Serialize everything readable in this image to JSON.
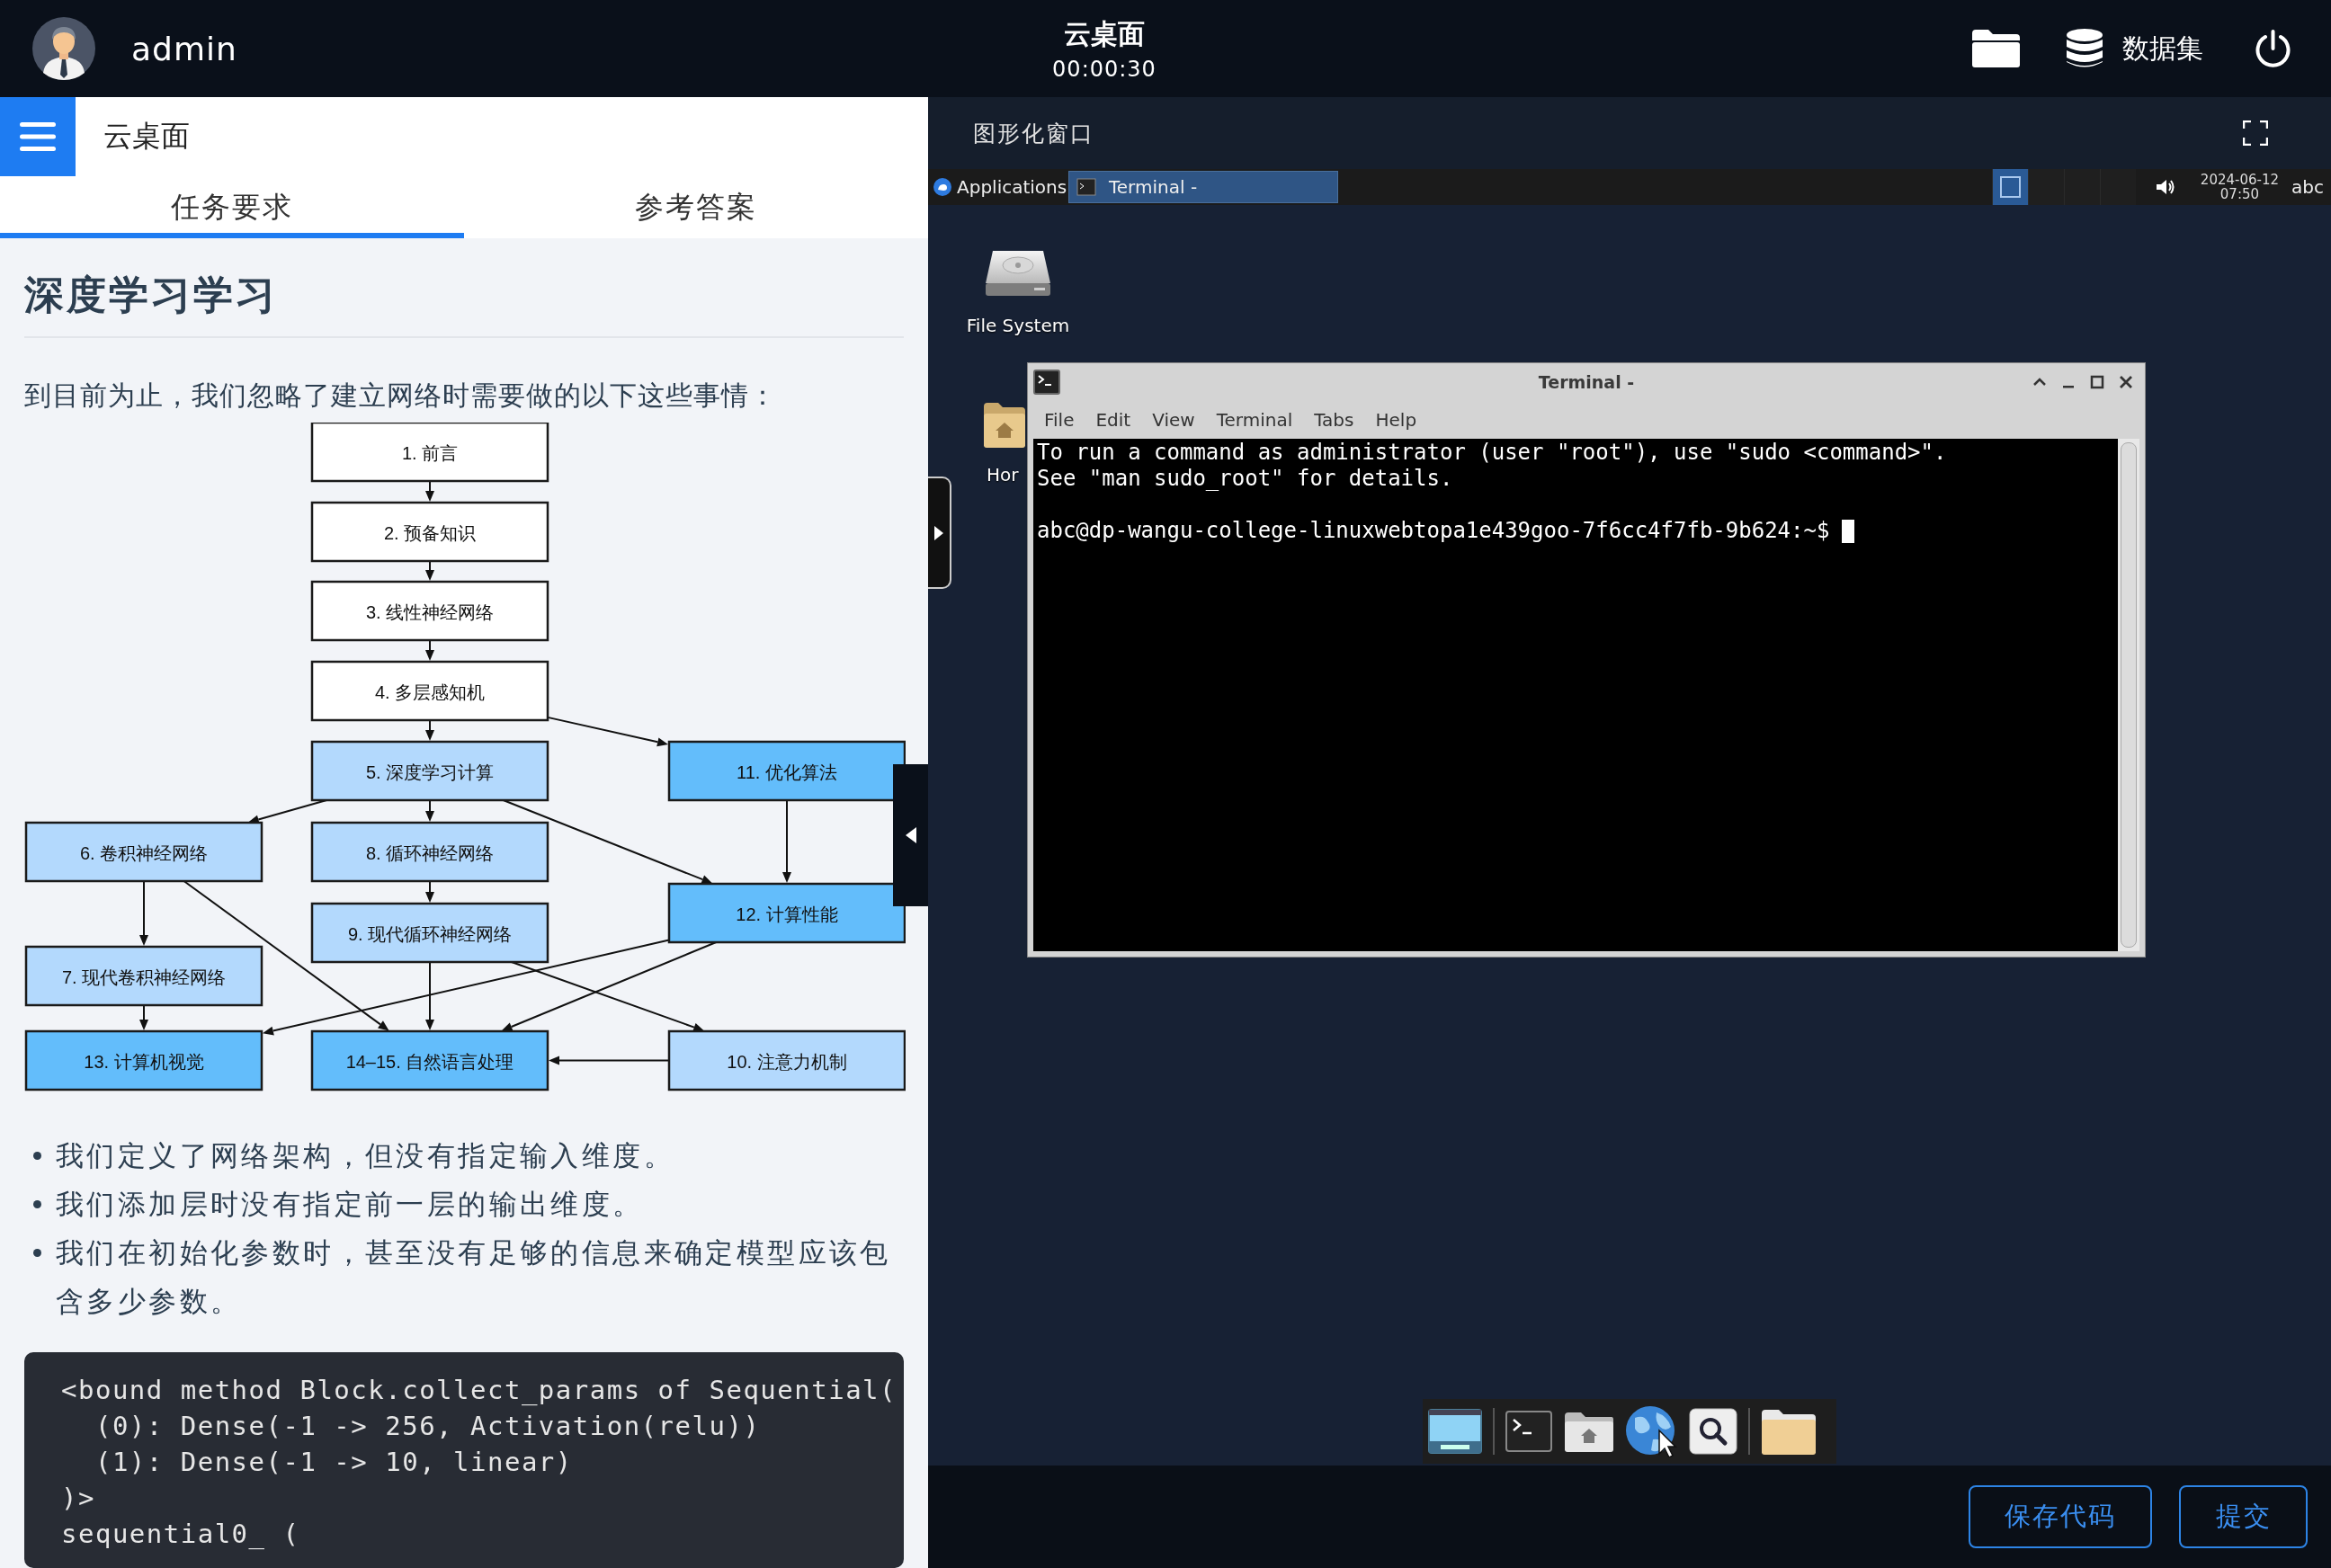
{
  "top_bar": {
    "user": "admin",
    "title": "云桌面",
    "timer": "00:00:30",
    "dataset_label": "数据集"
  },
  "task_panel": {
    "header_title": "云桌面",
    "tabs": [
      {
        "label": "任务要求",
        "selected": true
      },
      {
        "label": "参考答案",
        "selected": false
      }
    ],
    "heading": "深度学习学习",
    "intro": "到目前为止，我们忽略了建立网络时需要做的以下这些事情：",
    "diagram": {
      "nodes": [
        {
          "label": "1. 前言",
          "kind": "plain"
        },
        {
          "label": "2. 预备知识",
          "kind": "plain"
        },
        {
          "label": "3. 线性神经网络",
          "kind": "plain"
        },
        {
          "label": "4. 多层感知机",
          "kind": "plain"
        },
        {
          "label": "5. 深度学习计算",
          "kind": "light"
        },
        {
          "label": "11. 优化算法",
          "kind": "dark"
        },
        {
          "label": "6. 卷积神经网络",
          "kind": "light"
        },
        {
          "label": "8. 循环神经网络",
          "kind": "light"
        },
        {
          "label": "12. 计算性能",
          "kind": "dark"
        },
        {
          "label": "9. 现代循环神经网络",
          "kind": "light"
        },
        {
          "label": "7. 现代卷积神经网络",
          "kind": "light"
        },
        {
          "label": "13. 计算机视觉",
          "kind": "dark"
        },
        {
          "label": "14–15. 自然语言处理",
          "kind": "dark"
        },
        {
          "label": "10. 注意力机制",
          "kind": "light"
        }
      ]
    },
    "bullets": [
      "我们定义了网络架构，但没有指定输入维度。",
      "我们添加层时没有指定前一层的输出维度。",
      "我们在初始化参数时，甚至没有足够的信息来确定模型应该包含多少参数。"
    ],
    "code_lines": [
      "<bound method Block.collect_params of Sequential(",
      "  (0): Dense(-1 -> 256, Activation(relu))",
      "  (1): Dense(-1 -> 10, linear)",
      ")>",
      "sequential0_ ("
    ]
  },
  "remote_panel": {
    "title": "图形化窗口",
    "taskbar": {
      "menu_label": "Applications",
      "tasks": [
        {
          "label": "Terminal -",
          "selected": true
        }
      ],
      "workspaces": [
        {
          "selected": true
        },
        {
          "selected": false
        },
        {
          "selected": false
        },
        {
          "selected": false
        }
      ],
      "date": "2024-06-12",
      "time": "07:50",
      "keyboard_layout": "abc"
    },
    "desktop_icons": [
      {
        "kind": "drive",
        "label": "File System"
      },
      {
        "kind": "home",
        "label": "Hor"
      }
    ],
    "terminal": {
      "title": "Terminal -",
      "menu": [
        "File",
        "Edit",
        "View",
        "Terminal",
        "Tabs",
        "Help"
      ],
      "output": [
        "To run a command as administrator (user \"root\"), use \"sudo <command>\".",
        "See \"man sudo_root\" for details."
      ],
      "prompt": "abc@dp-wangu-college-linuxwebtopa1e439goo-7f6cc4f7fb-9b624:~$"
    },
    "buttons": [
      {
        "label": "保存代码"
      },
      {
        "label": "提交"
      }
    ]
  }
}
